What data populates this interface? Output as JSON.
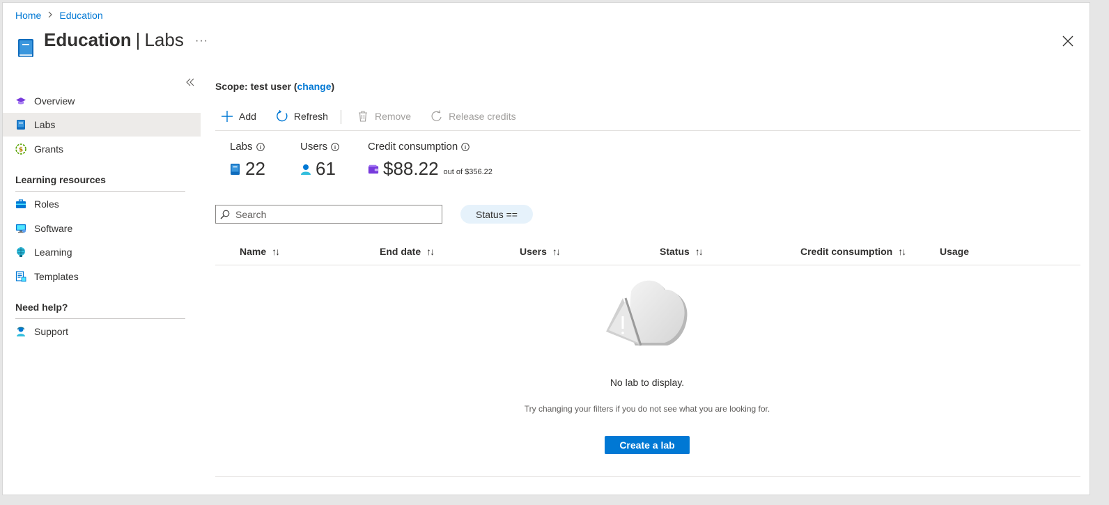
{
  "breadcrumb": {
    "items": [
      "Home",
      "Education"
    ]
  },
  "header": {
    "title": "Education",
    "subtitle": "Labs",
    "more": "···"
  },
  "sidebar": {
    "items": [
      {
        "label": "Overview",
        "icon": "mortarboard-icon"
      },
      {
        "label": "Labs",
        "icon": "book-icon",
        "active": true
      },
      {
        "label": "Grants",
        "icon": "dollar-coin-icon"
      }
    ],
    "section_learning": "Learning resources",
    "learning_items": [
      {
        "label": "Roles",
        "icon": "briefcase-icon"
      },
      {
        "label": "Software",
        "icon": "monitor-icon"
      },
      {
        "label": "Learning",
        "icon": "brain-icon"
      },
      {
        "label": "Templates",
        "icon": "templates-icon"
      }
    ],
    "section_help": "Need help?",
    "help_items": [
      {
        "label": "Support",
        "icon": "support-person-icon"
      }
    ]
  },
  "scope": {
    "prefix": "Scope: test user (",
    "link": "change",
    "suffix": ")"
  },
  "toolbar": {
    "add": "Add",
    "refresh": "Refresh",
    "remove": "Remove",
    "release": "Release credits"
  },
  "stats": {
    "labs_label": "Labs",
    "labs_value": "22",
    "users_label": "Users",
    "users_value": "61",
    "credit_label": "Credit consumption",
    "credit_value": "$88.22",
    "credit_total": "out of $356.22"
  },
  "search": {
    "placeholder": "Search",
    "value": ""
  },
  "filter": {
    "status_label": "Status =="
  },
  "table": {
    "columns": [
      "Name",
      "End date",
      "Users",
      "Status",
      "Credit consumption",
      "Usage"
    ],
    "sort_glyph": "↑↓"
  },
  "empty": {
    "title": "No lab to display.",
    "subtitle": "Try changing your filters if you do not see what you are looking for.",
    "button": "Create a lab"
  },
  "colors": {
    "accent": "#0078d4",
    "active_bg": "#edebe9",
    "pill_bg": "#e6f2fb"
  }
}
